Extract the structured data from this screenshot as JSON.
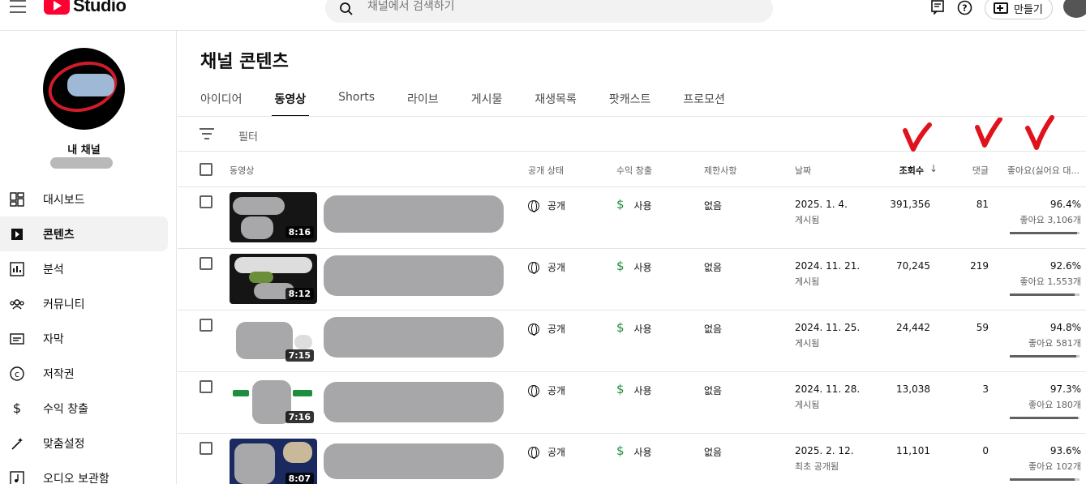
{
  "app": {
    "logo_text": "Studio"
  },
  "search": {
    "placeholder": "채널에서 검색하기"
  },
  "header": {
    "create_label": "만들기"
  },
  "sidebar": {
    "channel_name": "내 채널",
    "items": [
      {
        "label": "대시보드",
        "icon": "dashboard-icon"
      },
      {
        "label": "콘텐츠",
        "icon": "content-icon"
      },
      {
        "label": "분석",
        "icon": "analytics-icon"
      },
      {
        "label": "커뮤니티",
        "icon": "community-icon"
      },
      {
        "label": "자막",
        "icon": "subtitles-icon"
      },
      {
        "label": "저작권",
        "icon": "copyright-icon"
      },
      {
        "label": "수익 창출",
        "icon": "dollar-icon"
      },
      {
        "label": "맞춤설정",
        "icon": "magic-wand-icon"
      },
      {
        "label": "오디오 보관함",
        "icon": "audio-library-icon"
      }
    ]
  },
  "page": {
    "title": "채널 콘텐츠"
  },
  "tabs": [
    {
      "label": "아이디어"
    },
    {
      "label": "동영상"
    },
    {
      "label": "Shorts"
    },
    {
      "label": "라이브"
    },
    {
      "label": "게시물"
    },
    {
      "label": "재생목록"
    },
    {
      "label": "팟캐스트"
    },
    {
      "label": "프로모션"
    }
  ],
  "filter": {
    "placeholder": "필터"
  },
  "table": {
    "columns": {
      "video": "동영상",
      "visibility": "공개 상태",
      "monetization": "수익 창출",
      "restrictions": "제한사항",
      "date": "날짜",
      "views": "조회수",
      "sort_arrow": "↓",
      "comments": "댓글",
      "likes": "좋아요(싫어요 대..."
    },
    "rows": [
      {
        "duration": "8:16",
        "visibility": "공개",
        "monetization": "사용",
        "restrictions": "없음",
        "date": "2025. 1. 4.",
        "date_status": "게시됨",
        "views": "391,356",
        "comments": "81",
        "like_pct": "96.4%",
        "like_count": "좋아요 3,106개",
        "like_ratio": 0.964
      },
      {
        "duration": "8:12",
        "visibility": "공개",
        "monetization": "사용",
        "restrictions": "없음",
        "date": "2024. 11. 21.",
        "date_status": "게시됨",
        "views": "70,245",
        "comments": "219",
        "like_pct": "92.6%",
        "like_count": "좋아요 1,553개",
        "like_ratio": 0.926
      },
      {
        "duration": "7:15",
        "visibility": "공개",
        "monetization": "사용",
        "restrictions": "없음",
        "date": "2024. 11. 25.",
        "date_status": "게시됨",
        "views": "24,442",
        "comments": "59",
        "like_pct": "94.8%",
        "like_count": "좋아요 581개",
        "like_ratio": 0.948
      },
      {
        "duration": "7:16",
        "visibility": "공개",
        "monetization": "사용",
        "restrictions": "없음",
        "date": "2024. 11. 28.",
        "date_status": "게시됨",
        "views": "13,038",
        "comments": "3",
        "like_pct": "97.3%",
        "like_count": "좋아요 180개",
        "like_ratio": 0.973
      },
      {
        "duration": "8:07",
        "visibility": "공개",
        "monetization": "사용",
        "restrictions": "없음",
        "date": "2025. 2. 12.",
        "date_status": "최초 공개됨",
        "views": "11,101",
        "comments": "0",
        "like_pct": "93.6%",
        "like_count": "좋아요 102개",
        "like_ratio": 0.936
      }
    ]
  },
  "colors": {
    "accent_red": "#ff0033",
    "annotation_red": "#e0121b",
    "money_green": "#1e8e3e"
  }
}
